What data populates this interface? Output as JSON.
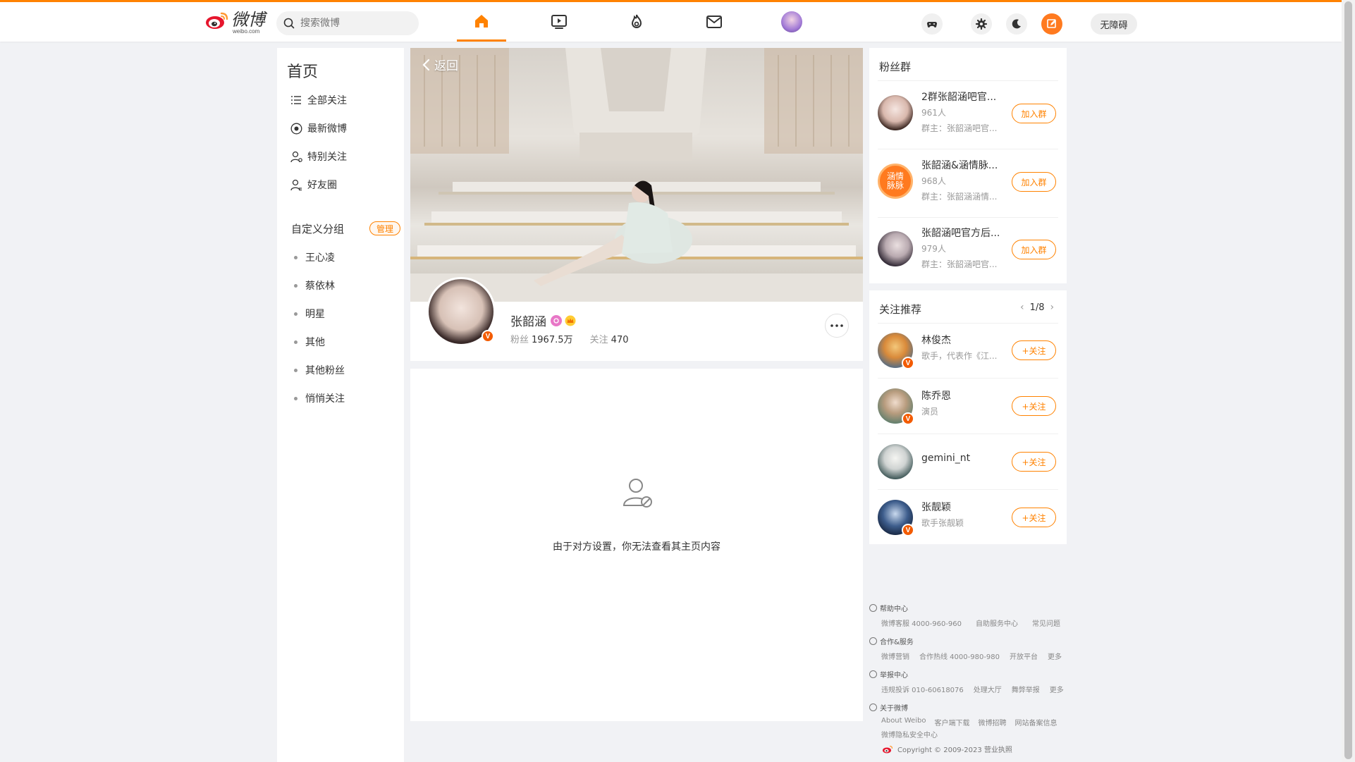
{
  "colors": {
    "accent": "#ff8200",
    "verify": "#f35b00",
    "bg": "#f1f2f5"
  },
  "header": {
    "logo_text": "微博",
    "logo_sub": "weibo.com",
    "search_placeholder": "搜索微博",
    "nav_icons": [
      "home-icon",
      "video-icon",
      "hot-icon",
      "message-icon",
      "user-avatar"
    ],
    "accessibility_label": "无障碍"
  },
  "sidebar": {
    "title": "首页",
    "items": [
      {
        "label": "全部关注",
        "icon": "list-icon"
      },
      {
        "label": "最新微博",
        "icon": "clock-icon"
      },
      {
        "label": "特别关注",
        "icon": "user-star-icon"
      },
      {
        "label": "好友圈",
        "icon": "friends-icon"
      }
    ],
    "group_title": "自定义分组",
    "manage_label": "管理",
    "groups": [
      "王心凌",
      "蔡依林",
      "明星",
      "其他",
      "其他粉丝",
      "悄悄关注"
    ]
  },
  "profile": {
    "back_label": "返回",
    "name": "张韶涵",
    "fans_label": "粉丝",
    "fans_count": "1967.5万",
    "following_label": "关注",
    "following_count": "470"
  },
  "content": {
    "empty_message": "由于对方设置，你无法查看其主页内容"
  },
  "fan_groups": {
    "title": "粉丝群",
    "items": [
      {
        "name": "2群张韶涵吧官...",
        "members": "961人",
        "owner": "群主：张韶涵吧官...",
        "button": "加入群"
      },
      {
        "name": "张韶涵&涵情脉...",
        "members": "968人",
        "owner": "群主：张韶涵涵情...",
        "button": "加入群",
        "avatar_text": "涵情\n脉脉"
      },
      {
        "name": "张韶涵吧官方后...",
        "members": "979人",
        "owner": "群主：张韶涵吧官...",
        "button": "加入群"
      }
    ]
  },
  "recommend": {
    "title": "关注推荐",
    "pager": "1/8",
    "items": [
      {
        "name": "林俊杰",
        "desc": "歌手，代表作《江...",
        "button": "+关注"
      },
      {
        "name": "陈乔恩",
        "desc": "演员",
        "button": "+关注"
      },
      {
        "name": "gemini_nt",
        "desc": "",
        "button": "+关注"
      },
      {
        "name": "张靓颖",
        "desc": "歌手张靓颖",
        "button": "+关注"
      }
    ]
  },
  "footer": {
    "sections": [
      {
        "title": "帮助中心",
        "links": [
          "微博客服 4000-960-960",
          "自助服务中心",
          "常见问题"
        ]
      },
      {
        "title": "合作&服务",
        "links": [
          "微博营销",
          "合作热线 4000-980-980",
          "开放平台",
          "更多"
        ]
      },
      {
        "title": "举报中心",
        "links": [
          "违规投诉 010-60618076",
          "处理大厅",
          "舞弊举报",
          "更多"
        ]
      },
      {
        "title": "关于微博",
        "links": [
          "About Weibo",
          "客户端下载",
          "微博招聘",
          "网站备案信息"
        ],
        "extra": "微博隐私安全中心"
      }
    ],
    "copyright": "Copyright © 2009-2023 营业执照"
  }
}
